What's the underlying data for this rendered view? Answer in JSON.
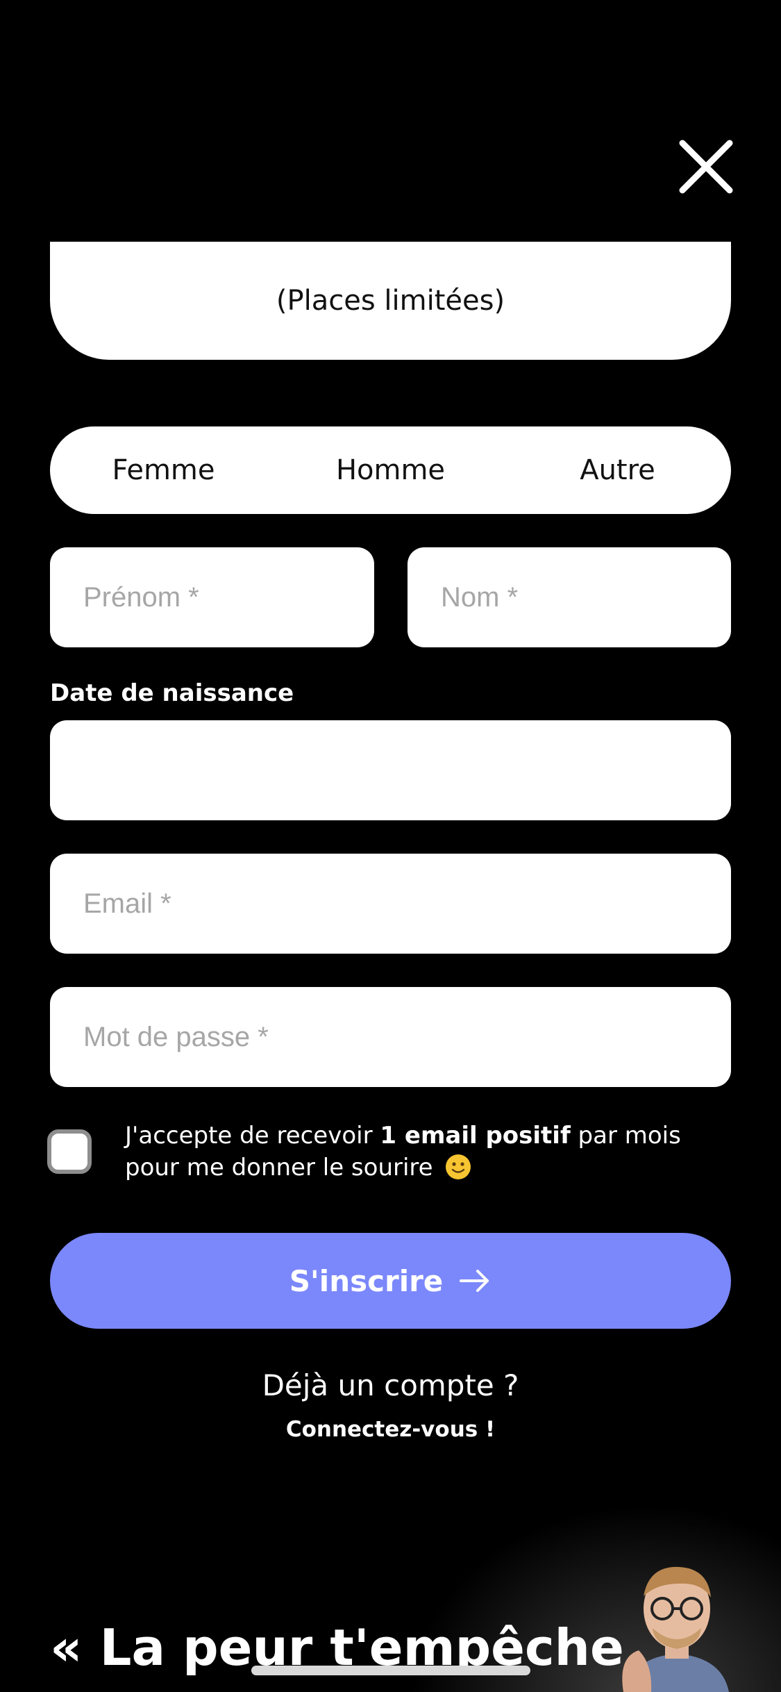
{
  "header": {
    "close_icon": "close-icon"
  },
  "places": {
    "text": "(Places limitées)"
  },
  "gender": {
    "options": [
      "Femme",
      "Homme",
      "Autre"
    ]
  },
  "form": {
    "first_name_placeholder": "Prénom *",
    "last_name_placeholder": "Nom *",
    "dob_label": "Date de naissance",
    "dob_value": "",
    "email_placeholder": "Email *",
    "password_placeholder": "Mot de passe *"
  },
  "consent": {
    "text_before": "J'accepte de recevoir ",
    "text_bold": "1 email positif",
    "text_after": " par mois pour me donner le sourire",
    "emoji_icon": "smiley-icon",
    "checked": false
  },
  "submit": {
    "label": "S'inscrire",
    "icon": "arrow-right-icon",
    "color": "#7b88fb"
  },
  "login": {
    "question": "Déjà un compte ?",
    "link": "Connectez-vous !"
  },
  "promo": {
    "quote_line1": "« La peur t'empêche"
  }
}
